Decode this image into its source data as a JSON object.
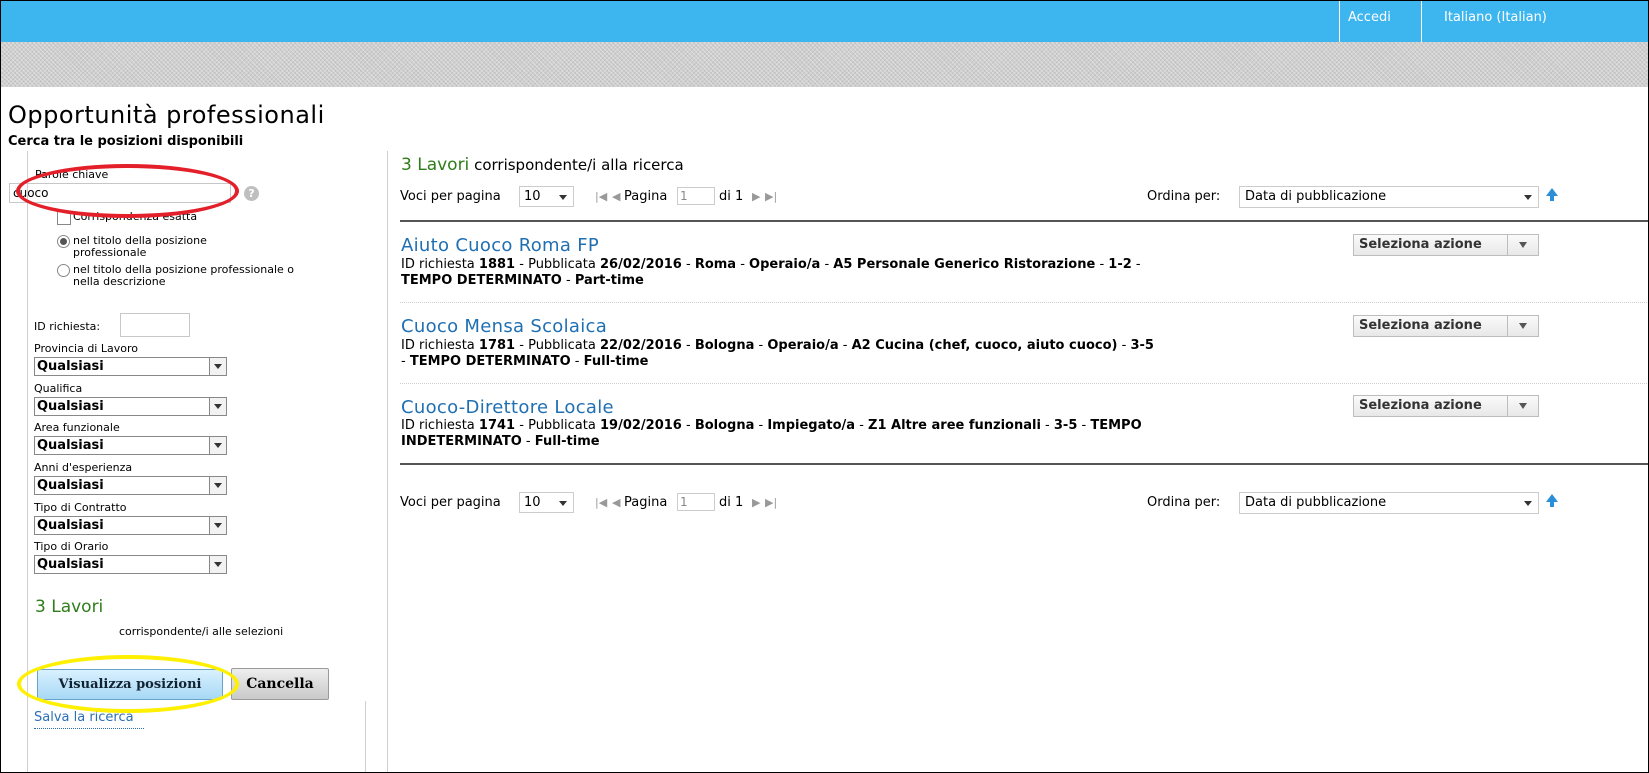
{
  "topbar": {
    "login": "Accedi",
    "language": "Italiano (Italian)"
  },
  "page": {
    "title": "Opportunità professionali",
    "subtitle": "Cerca tra le posizioni disponibili"
  },
  "filters": {
    "keywords_label": "Parole chiave",
    "keywords_value": "cuoco",
    "exact_match_label": "Corrispondenza esatta",
    "radio_title": "nel titolo della posizione professionale",
    "radio_title_desc": "nel titolo della posizione professionale o nella descrizione",
    "id_label": "ID richiesta:",
    "selects": [
      {
        "label": "Provincia di Lavoro",
        "value": "Qualsiasi"
      },
      {
        "label": "Qualifica",
        "value": "Qualsiasi"
      },
      {
        "label": "Area funzionale",
        "value": "Qualsiasi"
      },
      {
        "label": "Anni d'esperienza",
        "value": "Qualsiasi"
      },
      {
        "label": "Tipo di Contratto",
        "value": "Qualsiasi"
      },
      {
        "label": "Tipo di Orario",
        "value": "Qualsiasi"
      }
    ],
    "count": "3 Lavori",
    "count_sub": "corrispondente/i alle selezioni",
    "show_button": "Visualizza posizioni",
    "cancel_button": "Cancella",
    "save_link": "Salva la ricerca"
  },
  "results": {
    "count_num": "3 Lavori",
    "count_text": "corrispondente/i alla ricerca",
    "per_page_label": "Voci per pagina",
    "per_page_value": "10",
    "page_label": "Pagina",
    "page_value": "1",
    "of_label": "di 1",
    "sort_label": "Ordina per:",
    "sort_value": "Data di pubblicazione",
    "action_label": "Seleziona azione",
    "jobs": [
      {
        "title": "Aiuto Cuoco Roma FP",
        "id": "1881",
        "date": "26/02/2016",
        "city": "Roma",
        "role": "Operaio/a",
        "area": "A5 Personale Generico Ristorazione",
        "exp": "1-2",
        "contract": "TEMPO DETERMINATO",
        "time": "Part-time"
      },
      {
        "title": "Cuoco Mensa Scolaica",
        "id": "1781",
        "date": "22/02/2016",
        "city": "Bologna",
        "role": "Operaio/a",
        "area": "A2 Cucina (chef, cuoco, aiuto cuoco)",
        "exp": "3-5",
        "contract": "TEMPO DETERMINATO",
        "time": "Full-time"
      },
      {
        "title": "Cuoco-Direttore Locale",
        "id": "1741",
        "date": "19/02/2016",
        "city": "Bologna",
        "role": "Impiegato/a",
        "area": "Z1 Altre aree funzionali",
        "exp": "3-5",
        "contract": "TEMPO INDETERMINATO",
        "time": "Full-time"
      }
    ],
    "meta_labels": {
      "id": "ID richiesta",
      "published": "Pubblicata",
      "sep": " - "
    }
  },
  "colors": {
    "topbar": "#3db5ef",
    "count_green": "#2e7d1a",
    "link_blue": "#1f6fb3",
    "annotation_red": "#e3202a",
    "annotation_yellow": "#ffef00"
  }
}
